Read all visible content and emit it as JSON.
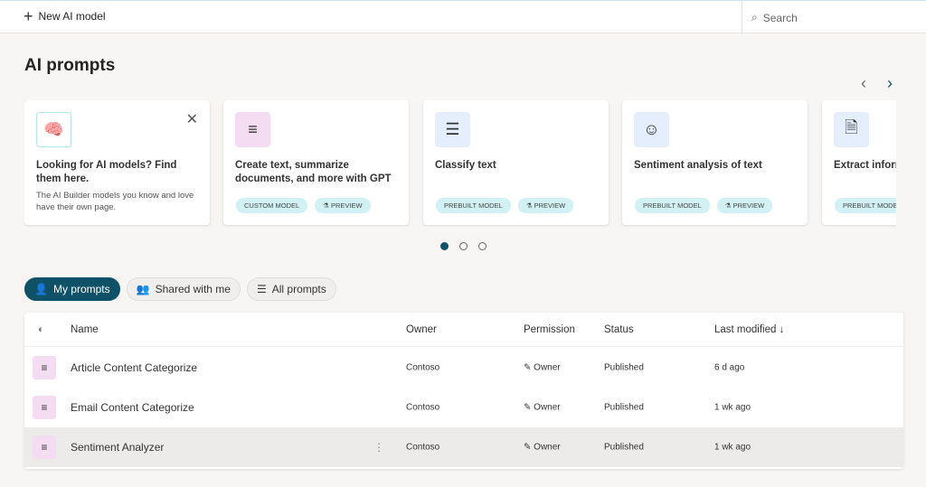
{
  "topbar": {
    "new_label": "New AI model",
    "search_placeholder": "Search"
  },
  "page_title": "AI prompts",
  "cards": [
    {
      "title": "Looking for AI models? Find them here.",
      "description": "The AI Builder models you know and love have their own page.",
      "icon": "brain-icon"
    },
    {
      "title": "Create text, summarize documents, and more with GPT",
      "tags": [
        "CUSTOM MODEL",
        "PREVIEW"
      ],
      "icon": "text-sparkle-icon"
    },
    {
      "title": "Classify text",
      "tags": [
        "PREBUILT MODEL",
        "PREVIEW"
      ],
      "icon": "text-columns-icon"
    },
    {
      "title": "Sentiment analysis of text",
      "tags": [
        "PREBUILT MODEL",
        "PREVIEW"
      ],
      "icon": "smiley-icon"
    },
    {
      "title": "Extract inform",
      "tags": [
        "PREBUILT MODE"
      ],
      "icon": "document-extract-icon"
    }
  ],
  "carousel": {
    "pages": 3,
    "current": 1
  },
  "filters": [
    {
      "label": "My prompts",
      "active": true
    },
    {
      "label": "Shared with me"
    },
    {
      "label": "All prompts"
    }
  ],
  "table": {
    "headers": {
      "name": "Name",
      "owner": "Owner",
      "permission": "Permission",
      "status": "Status",
      "modified": "Last modified ↓"
    },
    "rows": [
      {
        "name": "Article Content Categorize",
        "owner": "Contoso",
        "permission": "Owner",
        "status": "Published",
        "modified": "6 d ago"
      },
      {
        "name": "Email Content Categorize",
        "owner": "Contoso",
        "permission": "Owner",
        "status": "Published",
        "modified": "1 wk ago"
      },
      {
        "name": "Sentiment Analyzer",
        "owner": "Contoso",
        "permission": "Owner",
        "status": "Published",
        "modified": "1 wk ago",
        "selected": true
      }
    ]
  },
  "colors": {
    "accent": "#0f5167",
    "tag": "#d1f1f4",
    "custom_icon_bg": "#f4dcf2",
    "prebuilt_icon_bg": "#e4eefc"
  }
}
